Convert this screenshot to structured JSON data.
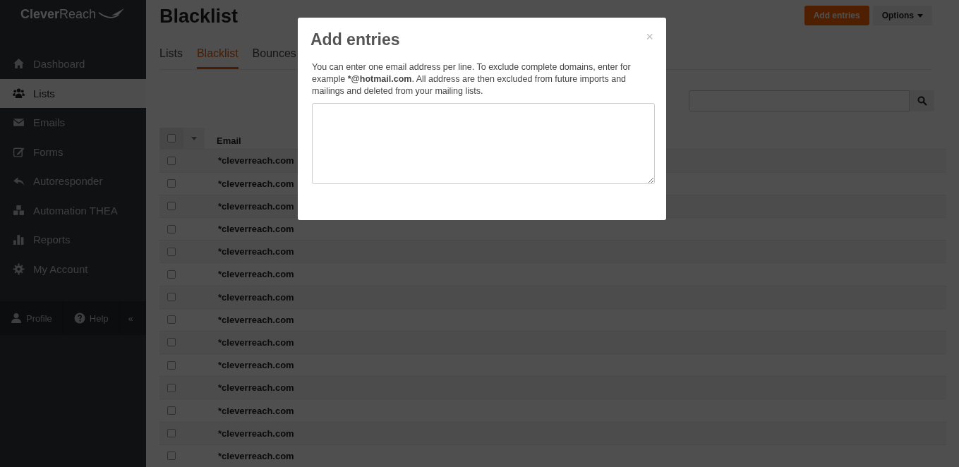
{
  "sidebar": {
    "logo": "**Clever**Reach",
    "items": [
      {
        "label": "Dashboard",
        "selected": false
      },
      {
        "label": "Lists",
        "selected": true
      },
      {
        "label": "Emails",
        "selected": false
      },
      {
        "label": "Forms",
        "selected": false
      },
      {
        "label": "Autoresponder",
        "selected": false
      },
      {
        "label": "Automation THEA",
        "selected": false
      },
      {
        "label": "Reports",
        "selected": false
      },
      {
        "label": "My Account",
        "selected": false
      }
    ],
    "footer": {
      "profile": "Profile",
      "help": "Help",
      "collapse": "«"
    }
  },
  "page_title": "Blacklist",
  "header_buttons": [
    {
      "label": "Add entries",
      "kind": "primary"
    },
    {
      "label": "Options",
      "kind": "dropdown"
    }
  ],
  "tabs": [
    {
      "label": "Lists",
      "selected": false
    },
    {
      "label": "Blacklist",
      "selected": true
    },
    {
      "label": "Bounces",
      "selected": false
    }
  ],
  "table": {
    "select_all_checked": false,
    "columns": [
      "Email"
    ],
    "rows": [
      {
        "email": "*cleverreach.com",
        "checked": false
      },
      {
        "email": "*cleverreach.com",
        "checked": false
      },
      {
        "email": "*cleverreach.com",
        "checked": false
      },
      {
        "email": "*cleverreach.com",
        "checked": false
      },
      {
        "email": "*cleverreach.com",
        "checked": false
      },
      {
        "email": "*cleverreach.com",
        "checked": false
      },
      {
        "email": "*cleverreach.com",
        "checked": false
      },
      {
        "email": "*cleverreach.com",
        "checked": false
      },
      {
        "email": "*cleverreach.com",
        "checked": false
      },
      {
        "email": "*cleverreach.com",
        "checked": false
      },
      {
        "email": "*cleverreach.com",
        "checked": false
      },
      {
        "email": "*cleverreach.com",
        "checked": false
      },
      {
        "email": "*cleverreach.com",
        "checked": false
      },
      {
        "email": "*cleverreach.com",
        "checked": false
      }
    ]
  },
  "modal": {
    "title": "Add entries",
    "close": "×",
    "text_parts": [
      {
        "text": "You can enter one email address per line. To exclude complete domains, enter for example ",
        "bold": false
      },
      {
        "text": "*@hotmail.com",
        "bold": true
      },
      {
        "text": ". All address are then excluded from future imports and mailings and deleted from your mailing lists.",
        "bold": false
      }
    ]
  }
}
